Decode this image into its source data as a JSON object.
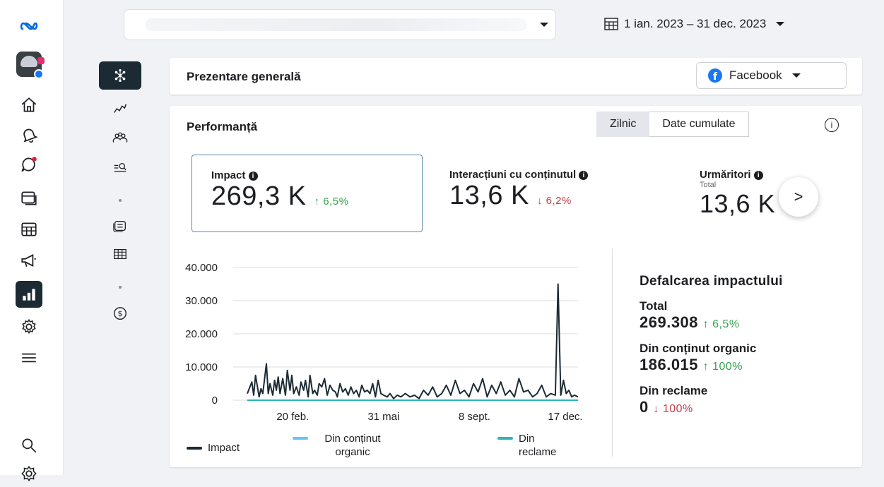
{
  "brand": {
    "name": "Meta"
  },
  "left_rail": {
    "items": [
      {
        "icon": "home-icon"
      },
      {
        "icon": "bell-icon"
      },
      {
        "icon": "message-icon"
      },
      {
        "icon": "content-icon"
      },
      {
        "icon": "calendar-icon"
      },
      {
        "icon": "megaphone-icon"
      },
      {
        "icon": "insights-icon",
        "active": true
      },
      {
        "icon": "gear-icon"
      },
      {
        "icon": "menu-icon"
      },
      {
        "icon": "search-icon"
      },
      {
        "icon": "settings-icon"
      }
    ]
  },
  "topbar": {
    "date_range": "1 ian. 2023 – 31 dec. 2023"
  },
  "overview": {
    "title": "Prezentare generală",
    "platform": "Facebook"
  },
  "performance": {
    "title": "Performanță",
    "toggle": {
      "daily": "Zilnic",
      "cumulative": "Date cumulate",
      "selected": "Zilnic"
    },
    "metrics": [
      {
        "label": "Impact",
        "value": "269,3 K",
        "change": "6,5%",
        "direction": "up",
        "selected": true
      },
      {
        "label": "Interacțiuni cu conținutul",
        "value": "13,6 K",
        "change": "6,2%",
        "direction": "down"
      },
      {
        "label": "Urmăritori",
        "sublabel": "Total",
        "value": "13,6 K"
      }
    ],
    "breakdown": {
      "title": "Defalcarea impactului",
      "rows": [
        {
          "label": "Total",
          "value": "269.308",
          "change": "6,5%",
          "direction": "up"
        },
        {
          "label": "Din conținut organic",
          "value": "186.015",
          "change": "100%",
          "direction": "up"
        },
        {
          "label": "Din reclame",
          "value": "0",
          "change": "100%",
          "direction": "down"
        }
      ]
    }
  },
  "chart_data": {
    "type": "line",
    "title": "",
    "xlabel": "",
    "ylabel": "",
    "ylim": [
      0,
      40000
    ],
    "yticks": [
      "40.000",
      "30.000",
      "20.000",
      "10.000",
      "0"
    ],
    "ytick_values": [
      40000,
      30000,
      20000,
      10000,
      0
    ],
    "xticks": [
      "20 feb.",
      "31 mai",
      "8 sept.",
      "17 dec."
    ],
    "xtick_days": [
      51,
      151,
      251,
      351
    ],
    "x_domain_days": [
      1,
      365
    ],
    "grid": true,
    "legend_placement": "bottom",
    "series": [
      {
        "name": "Impact",
        "color": "#1c2b33",
        "x_days": [
          1,
          6,
          8,
          10,
          14,
          16,
          18,
          22,
          24,
          26,
          29,
          31,
          33,
          35,
          37,
          40,
          43,
          45,
          48,
          50,
          52,
          55,
          58,
          60,
          63,
          65,
          68,
          70,
          73,
          75,
          78,
          80,
          83,
          86,
          89,
          92,
          95,
          98,
          100,
          103,
          106,
          109,
          112,
          115,
          118,
          121,
          124,
          127,
          130,
          133,
          136,
          139,
          142,
          145,
          148,
          151,
          155,
          158,
          162,
          166,
          170,
          175,
          180,
          185,
          190,
          195,
          200,
          205,
          210,
          215,
          220,
          225,
          230,
          235,
          240,
          245,
          250,
          255,
          260,
          265,
          270,
          275,
          280,
          285,
          290,
          295,
          300,
          305,
          310,
          315,
          320,
          325,
          330,
          335,
          340,
          343,
          346,
          349,
          352,
          355,
          358,
          361,
          365
        ],
        "y": [
          2000,
          5500,
          1500,
          7500,
          1000,
          3500,
          2000,
          11000,
          2000,
          5000,
          1500,
          6000,
          3000,
          7000,
          2000,
          6500,
          1500,
          9000,
          3000,
          7500,
          2000,
          4000,
          1500,
          5500,
          3000,
          6000,
          1000,
          7500,
          2000,
          3000,
          1500,
          5000,
          4000,
          6500,
          1500,
          4500,
          3000,
          2500,
          1000,
          5000,
          2500,
          3500,
          1500,
          4000,
          2000,
          3000,
          1000,
          4500,
          2500,
          3000,
          2000,
          5000,
          1000,
          6000,
          2000,
          1500,
          1000,
          2000,
          500,
          1500,
          1000,
          2000,
          1000,
          1500,
          500,
          3000,
          1500,
          4000,
          1000,
          2000,
          4500,
          1500,
          6000,
          2000,
          3000,
          1000,
          5000,
          2500,
          6500,
          1000,
          4500,
          2000,
          5500,
          1500,
          3000,
          1000,
          6500,
          2500,
          3000,
          1000,
          2000,
          4500,
          1000,
          2000,
          1500,
          35000,
          1500,
          6000,
          2000,
          3000,
          1000,
          1500,
          1000
        ]
      },
      {
        "name": "Din conținut organic",
        "color": "#69c3f2",
        "x_days": [
          1,
          365
        ],
        "y": [
          0,
          0
        ]
      },
      {
        "name": "Din reclame",
        "color": "#2bb5b5",
        "x_days": [
          1,
          365
        ],
        "y": [
          0,
          0
        ]
      }
    ]
  }
}
